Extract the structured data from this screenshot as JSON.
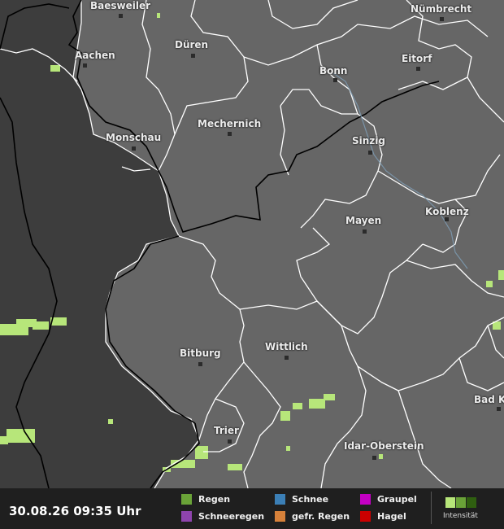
{
  "timestamp": "30.08.26 09:35 Uhr",
  "colors": {
    "land_inside": "#666666",
    "land_outside": "#3d3d3d",
    "border_line": "#ffffff",
    "state_border": "#000000",
    "rain_light": "#b7e67a",
    "rain_mid": "#6aa338",
    "rain_dark": "#2f5f10"
  },
  "cities": [
    {
      "name": "Baesweiler"
    },
    {
      "name": "Nümbrecht"
    },
    {
      "name": "Düren"
    },
    {
      "name": "Aachen"
    },
    {
      "name": "Eitorf"
    },
    {
      "name": "Bonn"
    },
    {
      "name": "Mechernich"
    },
    {
      "name": "Monschau"
    },
    {
      "name": "Sinzig"
    },
    {
      "name": "Mayen"
    },
    {
      "name": "Koblenz"
    },
    {
      "name": "Bitburg"
    },
    {
      "name": "Wittlich"
    },
    {
      "name": "Bad K"
    },
    {
      "name": "Trier"
    },
    {
      "name": "Idar-Oberstein"
    }
  ],
  "legend": {
    "items": [
      {
        "label": "Regen",
        "color": "#6aa338"
      },
      {
        "label": "Schneeregen",
        "color": "#8e44ad"
      },
      {
        "label": "Schnee",
        "color": "#3b7fb6"
      },
      {
        "label": "gefr. Regen",
        "color": "#d7813a"
      },
      {
        "label": "Graupel",
        "color": "#c400c4"
      },
      {
        "label": "Hagel",
        "color": "#cc0000"
      }
    ],
    "intensity_label": "Intensität",
    "intensity_colors": [
      "#b7e67a",
      "#6aa338",
      "#2f5f10"
    ]
  }
}
